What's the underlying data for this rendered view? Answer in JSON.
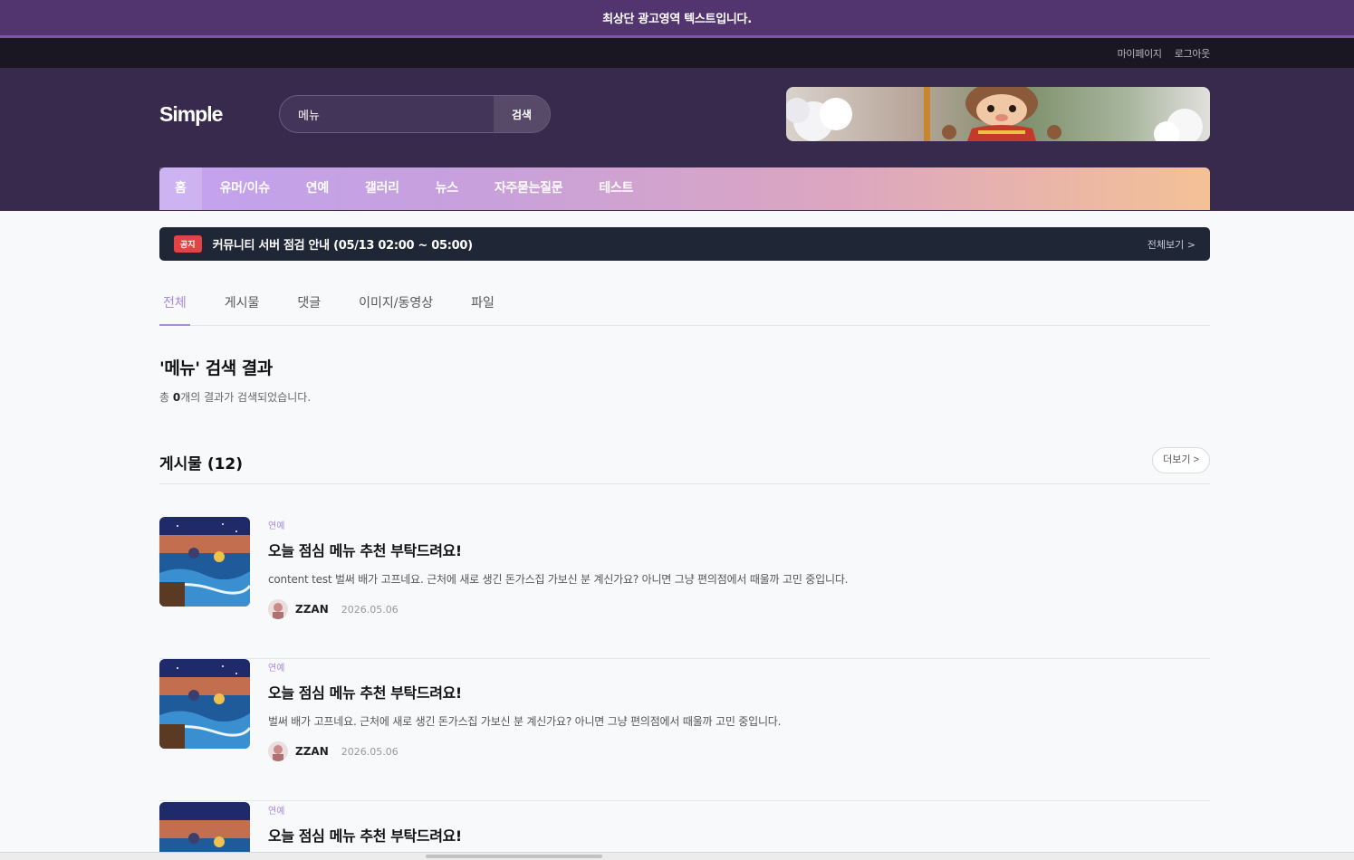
{
  "topbar": {
    "text": "최상단 광고영역 텍스트입니다."
  },
  "util": {
    "mypage": "마이페이지",
    "logout": "로그아웃"
  },
  "header": {
    "logo": "Simple",
    "search_value": "메뉴",
    "search_button": "검색"
  },
  "nav": {
    "items": [
      "홈",
      "유머/이슈",
      "연예",
      "갤러리",
      "뉴스",
      "자주묻는질문",
      "테스트"
    ]
  },
  "notice": {
    "badge": "공지",
    "text": "커뮤니티 서버 점검 안내 (05/13 02:00 ~ 05:00)",
    "more": "전체보기 >"
  },
  "tabs": [
    "전체",
    "게시물",
    "댓글",
    "이미지/동영상",
    "파일"
  ],
  "result": {
    "title": "'메뉴' 검색 결과",
    "prefix": "총 ",
    "count": "0",
    "suffix": "개의 결과가 검색되었습니다."
  },
  "section": {
    "title": "게시물 (12)",
    "more": "더보기 >"
  },
  "posts": [
    {
      "category": "연예",
      "title": "오늘 점심 메뉴 추천 부탁드려요!",
      "desc": "content test 벌써 배가 고프네요. 근처에 새로 생긴 돈가스집 가보신 분 계신가요? 아니면 그냥 편의점에서 때울까 고민 중입니다.",
      "author": "ZZAN",
      "date": "2026.05.06"
    },
    {
      "category": "연예",
      "title": "오늘 점심 메뉴 추천 부탁드려요!",
      "desc": "벌써 배가 고프네요. 근처에 새로 생긴 돈가스집 가보신 분 계신가요? 아니면 그냥 편의점에서 때울까 고민 중입니다.",
      "author": "ZZAN",
      "date": "2026.05.06"
    },
    {
      "category": "연예",
      "title": "오늘 점심 메뉴 추천 부탁드려요!"
    }
  ]
}
